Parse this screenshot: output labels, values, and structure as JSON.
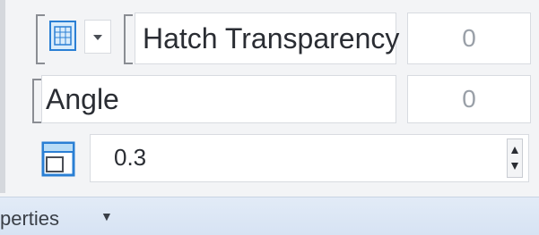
{
  "properties": {
    "hatch_transparency": {
      "label": "Hatch Transparency",
      "value": "0"
    },
    "angle": {
      "label": "Angle",
      "value": "0"
    },
    "line_width": {
      "value": "0.3"
    }
  },
  "icons": {
    "hatch_pattern": "hatch-pattern-icon",
    "dropdown": "chevron-down-icon",
    "line_width": "line-width-icon",
    "spin": "spin-arrows-icon"
  },
  "footer": {
    "label": "perties"
  },
  "colors": {
    "accent": "#2a7fd4"
  }
}
